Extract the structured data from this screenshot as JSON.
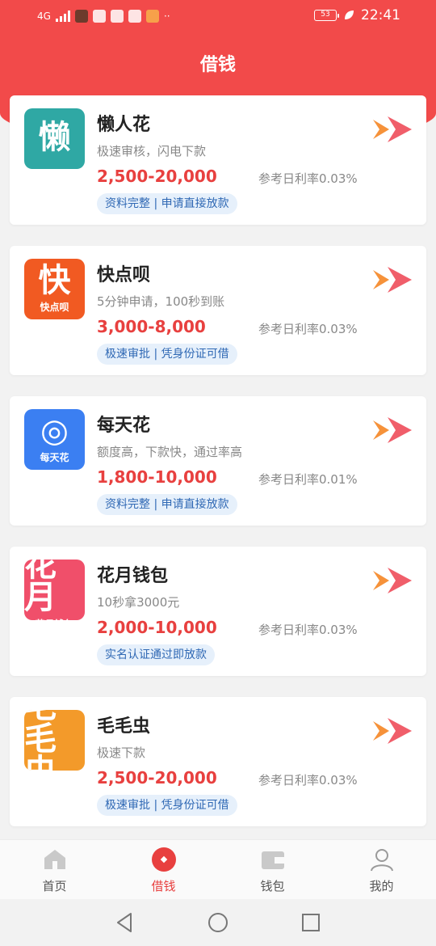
{
  "status_bar": {
    "network": "4G",
    "battery": "53",
    "time": "22:41"
  },
  "header": {
    "title": "借钱"
  },
  "loans": [
    {
      "name": "懒人花",
      "logo_char": "懒",
      "logo_sub": "",
      "logo_color": "#2fa8a4",
      "desc": "极速审核，闪电下款",
      "amount": "2,500-20,000",
      "rate": "参考日利率0.03%",
      "tags": "资料完整 | 申请直接放款"
    },
    {
      "name": "快点呗",
      "logo_char": "快",
      "logo_sub": "快点呗",
      "logo_color": "#f15a22",
      "desc": "5分钟申请，100秒到账",
      "amount": "3,000-8,000",
      "rate": "参考日利率0.03%",
      "tags": "极速审批 | 凭身份证可借"
    },
    {
      "name": "每天花",
      "logo_char": "◎",
      "logo_sub": "每天花",
      "logo_color": "#3b7ff2",
      "desc": "额度高，下款快，通过率高",
      "amount": "1,800-10,000",
      "rate": "参考日利率0.01%",
      "tags": "资料完整 | 申请直接放款"
    },
    {
      "name": "花月钱包",
      "logo_char": "花月",
      "logo_sub": "花月钱包",
      "logo_color": "#f04f6a",
      "desc": "10秒拿3000元",
      "amount": "2,000-10,000",
      "rate": "参考日利率0.03%",
      "tags": "实名认证通过即放款"
    },
    {
      "name": "毛毛虫",
      "logo_char": "毛毛虫",
      "logo_sub": "",
      "logo_color": "#f39a2a",
      "desc": "极速下款",
      "amount": "2,500-20,000",
      "rate": "参考日利率0.03%",
      "tags": "极速审批 | 凭身份证可借"
    }
  ],
  "tabs": [
    {
      "label": "首页",
      "icon": "home-icon"
    },
    {
      "label": "借钱",
      "icon": "borrow-icon",
      "active": true
    },
    {
      "label": "钱包",
      "icon": "wallet-icon"
    },
    {
      "label": "我的",
      "icon": "profile-icon"
    }
  ],
  "colors": {
    "primary": "#f24a4a",
    "amount": "#e8403f",
    "tag_bg": "#e6f0fb",
    "tag_text": "#2f68b4"
  }
}
